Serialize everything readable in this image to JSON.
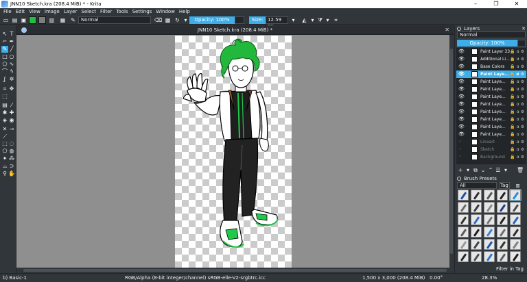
{
  "window": {
    "title": "JNN10 Sketch.kra (208.4 MiB) * - Krita",
    "minimize": "–",
    "maximize": "❐",
    "close": "✕"
  },
  "menu": [
    "File",
    "Edit",
    "View",
    "Image",
    "Layer",
    "Select",
    "Filter",
    "Tools",
    "Settings",
    "Window",
    "Help"
  ],
  "toolbar": {
    "blend_mode": "Normal",
    "opacity_label": "Opacity: 100%",
    "size_label": "Size:",
    "size_value": "12.59 px",
    "fg_color": "#20c040",
    "bg_color": "#7d7d7d"
  },
  "document": {
    "tab_title": "JNN10 Sketch.kra (208.4 MiB) *",
    "close": "✕"
  },
  "layers_docker": {
    "title": "Layers",
    "blend_mode": "Normal",
    "opacity_label": "Opacity: 100%",
    "layers": [
      {
        "name": "Paint Layer 33",
        "visible": true,
        "selected": false,
        "dim": false
      },
      {
        "name": "Additional Li...",
        "visible": true,
        "selected": false,
        "dim": false
      },
      {
        "name": "Base Colors",
        "visible": true,
        "selected": false,
        "dim": false
      },
      {
        "name": "Paint Laye...",
        "visible": true,
        "selected": true,
        "dim": false
      },
      {
        "name": "Paint Laye...",
        "visible": true,
        "selected": false,
        "dim": false
      },
      {
        "name": "Paint Laye...",
        "visible": true,
        "selected": false,
        "dim": false
      },
      {
        "name": "Paint Laye...",
        "visible": true,
        "selected": false,
        "dim": false
      },
      {
        "name": "Paint Laye...",
        "visible": true,
        "selected": false,
        "dim": false
      },
      {
        "name": "Paint Laye...",
        "visible": true,
        "selected": false,
        "dim": false
      },
      {
        "name": "Paint Laye...",
        "visible": true,
        "selected": false,
        "dim": false
      },
      {
        "name": "Paint Laye...",
        "visible": true,
        "selected": false,
        "dim": false
      },
      {
        "name": "Paint Laye...",
        "visible": true,
        "selected": false,
        "dim": false
      },
      {
        "name": "Lineart",
        "visible": false,
        "selected": false,
        "dim": true
      },
      {
        "name": "Sketch",
        "visible": false,
        "selected": false,
        "dim": true
      },
      {
        "name": "Background",
        "visible": false,
        "selected": false,
        "dim": true
      }
    ],
    "layer_flags": "🔒 α ⚙"
  },
  "brush_docker": {
    "title": "Brush Presets",
    "filter_all": "All",
    "tag_label": "Tag",
    "filter_in_tag": "Filter in Tag",
    "brush_colors": [
      "#1f4fa8",
      "#2d2d2d",
      "#555555",
      "#1f1f1f",
      "#2a8ad8",
      "#6b6b6b",
      "#3a3a3a",
      "#888888",
      "#1c3f8a",
      "#4a4a4a",
      "#303030",
      "#2e6bc7",
      "#777777",
      "#222222",
      "#2563c4",
      "#5a5a5a",
      "#1d1d1d",
      "#3b82d6",
      "#6e6e6e",
      "#2b2b2b",
      "#9a9a9a",
      "#424242",
      "#1a55b0",
      "#333333",
      "#808080",
      "#262626",
      "#4d4d4d",
      "#2f74cf",
      "#5f5f5f",
      "#191919"
    ]
  },
  "statusbar": {
    "brush": "b) Basic-1",
    "color_model": "RGB/Alpha (8-bit integer/channel)  sRGB-elle-V2-srgbtrc.icc",
    "dimensions": "1,500 x 3,000 (208.4 MiB)",
    "rotation": "0.00°",
    "zoom": "28.3%"
  }
}
